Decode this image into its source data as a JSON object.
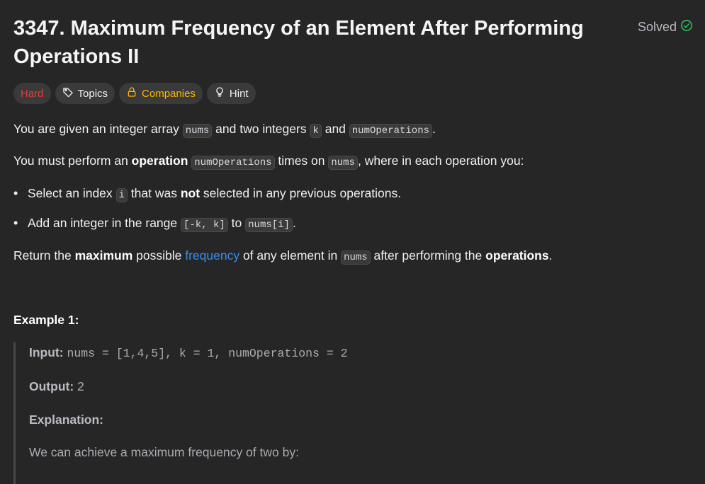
{
  "problem": {
    "title": "3347. Maximum Frequency of an Element After Performing Operations II",
    "status": "Solved"
  },
  "tags": {
    "difficulty": "Hard",
    "topics": "Topics",
    "companies": "Companies",
    "hint": "Hint"
  },
  "description": {
    "p1": {
      "a": "You are given an integer array ",
      "code1": "nums",
      "b": " and two integers ",
      "code2": "k",
      "c": " and ",
      "code3": "numOperations",
      "d": "."
    },
    "p2": {
      "a": "You must perform an ",
      "bold": "operation",
      "code1": "numOperations",
      "b": " times on ",
      "code2": "nums",
      "c": ", where in each operation you:"
    },
    "bullet1": {
      "a": "Select an index ",
      "code": "i",
      "b": " that was ",
      "bold": "not",
      "c": " selected in any previous operations."
    },
    "bullet2": {
      "a": "Add an integer in the range ",
      "code1": "[-k, k]",
      "b": " to ",
      "code2": "nums[i]",
      "c": "."
    },
    "p3": {
      "a": "Return the ",
      "bold1": "maximum",
      "b": " possible ",
      "link": "frequency",
      "c": " of any element in ",
      "code": "nums",
      "d": " after performing the ",
      "bold2": "operations",
      "e": "."
    }
  },
  "example": {
    "title": "Example 1:",
    "input_label": "Input:",
    "input_value": "nums = [1,4,5], k = 1, numOperations = 2",
    "output_label": "Output:",
    "output_value": "2",
    "explanation_label": "Explanation:",
    "explanation_text": "We can achieve a maximum frequency of two by:"
  }
}
